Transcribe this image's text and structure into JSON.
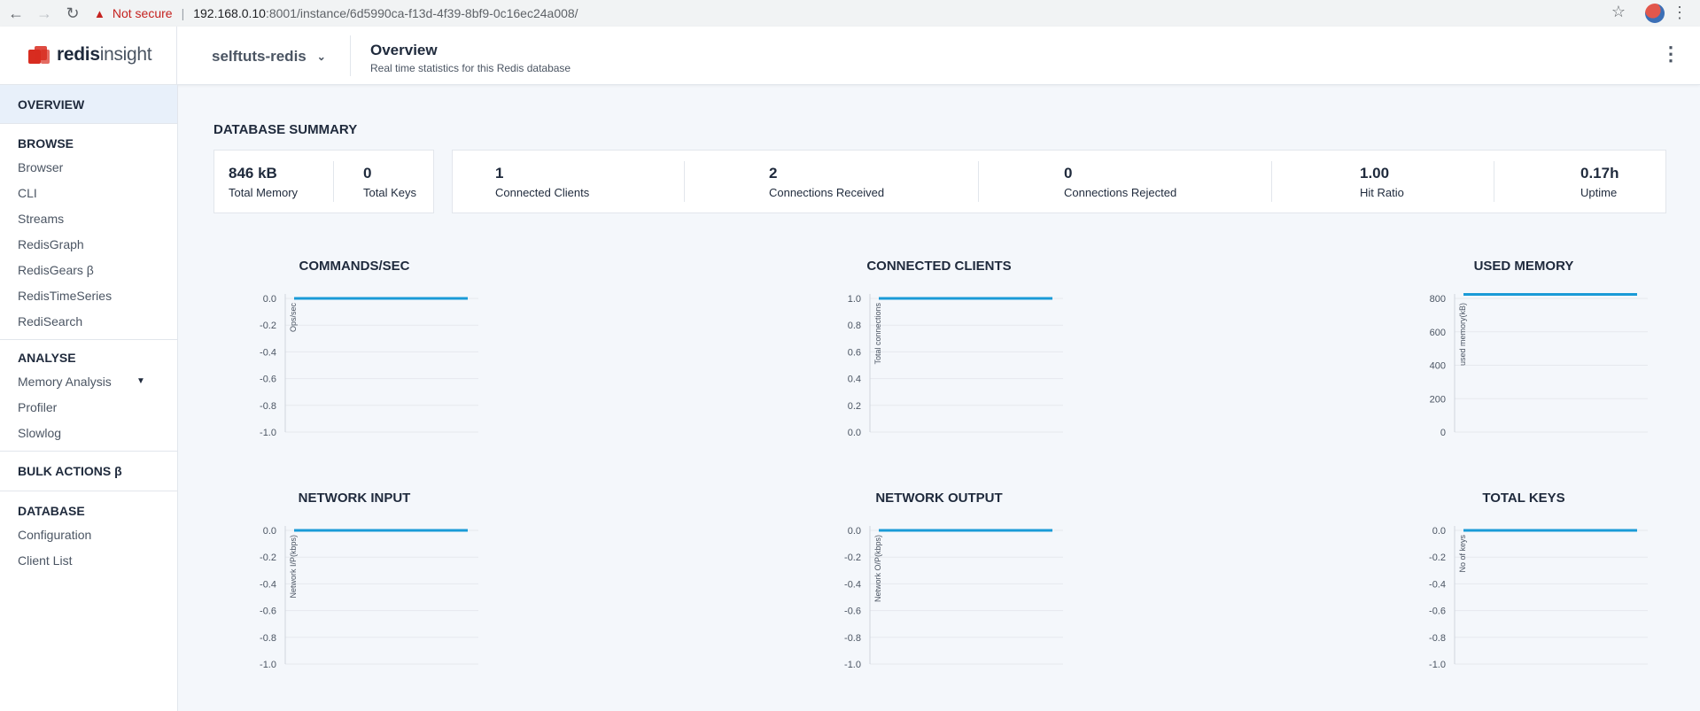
{
  "browser": {
    "not_secure": "Not secure",
    "url_host": "192.168.0.10",
    "url_rest": ":8001/instance/6d5990ca-f13d-4f39-8bf9-0c16ec24a008/"
  },
  "app": {
    "logo_bold": "redis",
    "logo_light": "insight",
    "db_name": "selftuts-redis",
    "page_title": "Overview",
    "page_subtitle": "Real time statistics for this Redis database"
  },
  "sidebar": {
    "active": "OVERVIEW",
    "sections": [
      {
        "heading": "BROWSE",
        "items": [
          "Browser",
          "CLI",
          "Streams",
          "RedisGraph",
          "RedisGears  β",
          "RedisTimeSeries",
          "RediSearch"
        ]
      },
      {
        "heading": "ANALYSE",
        "items": [
          "Memory Analysis",
          "Profiler",
          "Slowlog"
        ]
      },
      {
        "heading": "BULK ACTIONS  β",
        "items": []
      },
      {
        "heading": "DATABASE",
        "items": [
          "Configuration",
          "Client List"
        ]
      }
    ]
  },
  "summary": {
    "title": "DATABASE SUMMARY",
    "left": [
      {
        "value": "846 kB",
        "label": "Total Memory"
      },
      {
        "value": "0",
        "label": "Total Keys"
      }
    ],
    "right": [
      {
        "value": "1",
        "label": "Connected Clients"
      },
      {
        "value": "2",
        "label": "Connections Received"
      },
      {
        "value": "0",
        "label": "Connections Rejected"
      },
      {
        "value": "1.00",
        "label": "Hit Ratio"
      },
      {
        "value": "0.17h",
        "label": "Uptime"
      }
    ]
  },
  "charts": [
    {
      "title": "COMMANDS/SEC",
      "ylabel": "Ops/sec",
      "ticks": [
        "0.0",
        "-0.2",
        "-0.4",
        "-0.6",
        "-0.8",
        "-1.0"
      ],
      "values": [
        0,
        0
      ],
      "ylim": [
        -1.0,
        0.0
      ]
    },
    {
      "title": "CONNECTED CLIENTS",
      "ylabel": "Total connections",
      "ticks": [
        "1.0",
        "0.8",
        "0.6",
        "0.4",
        "0.2",
        "0.0"
      ],
      "values": [
        1,
        1
      ],
      "ylim": [
        0.0,
        1.0
      ]
    },
    {
      "title": "USED MEMORY",
      "ylabel": "used memory(kB)",
      "ticks": [
        "800",
        "600",
        "400",
        "200",
        "0"
      ],
      "values": [
        846,
        846
      ],
      "ylim": [
        0,
        800
      ]
    },
    {
      "title": "NETWORK INPUT",
      "ylabel": "Network I/P(kbps)",
      "ticks": [
        "0.0",
        "-0.2",
        "-0.4",
        "-0.6",
        "-0.8",
        "-1.0"
      ],
      "values": [
        0,
        0
      ],
      "ylim": [
        -1.0,
        0.0
      ]
    },
    {
      "title": "NETWORK OUTPUT",
      "ylabel": "Network O/P(kbps)",
      "ticks": [
        "0.0",
        "-0.2",
        "-0.4",
        "-0.6",
        "-0.8",
        "-1.0"
      ],
      "values": [
        0,
        0
      ],
      "ylim": [
        -1.0,
        0.0
      ]
    },
    {
      "title": "TOTAL KEYS",
      "ylabel": "No of keys",
      "ticks": [
        "0.0",
        "-0.2",
        "-0.4",
        "-0.6",
        "-0.8",
        "-1.0"
      ],
      "values": [
        0,
        0
      ],
      "ylim": [
        -1.0,
        0.0
      ]
    }
  ],
  "chart_data": [
    {
      "type": "line",
      "title": "COMMANDS/SEC",
      "ylabel": "Ops/sec",
      "ylim": [
        -1.0,
        0.0
      ],
      "series": [
        {
          "values": [
            0,
            0
          ]
        }
      ]
    },
    {
      "type": "line",
      "title": "CONNECTED CLIENTS",
      "ylabel": "Total connections",
      "ylim": [
        0.0,
        1.0
      ],
      "series": [
        {
          "values": [
            1,
            1
          ]
        }
      ]
    },
    {
      "type": "line",
      "title": "USED MEMORY",
      "ylabel": "used memory(kB)",
      "ylim": [
        0,
        800
      ],
      "series": [
        {
          "values": [
            846,
            846
          ]
        }
      ]
    },
    {
      "type": "line",
      "title": "NETWORK INPUT",
      "ylabel": "Network I/P(kbps)",
      "ylim": [
        -1.0,
        0.0
      ],
      "series": [
        {
          "values": [
            0,
            0
          ]
        }
      ]
    },
    {
      "type": "line",
      "title": "NETWORK OUTPUT",
      "ylabel": "Network O/P(kbps)",
      "ylim": [
        -1.0,
        0.0
      ],
      "series": [
        {
          "values": [
            0,
            0
          ]
        }
      ]
    },
    {
      "type": "line",
      "title": "TOTAL KEYS",
      "ylabel": "No of keys",
      "ylim": [
        -1.0,
        0.0
      ],
      "series": [
        {
          "values": [
            0,
            0
          ]
        }
      ]
    }
  ],
  "colors": {
    "accent": "#1a9bd7",
    "logo": "#d82c20",
    "active_bg": "#e8f0fa"
  }
}
